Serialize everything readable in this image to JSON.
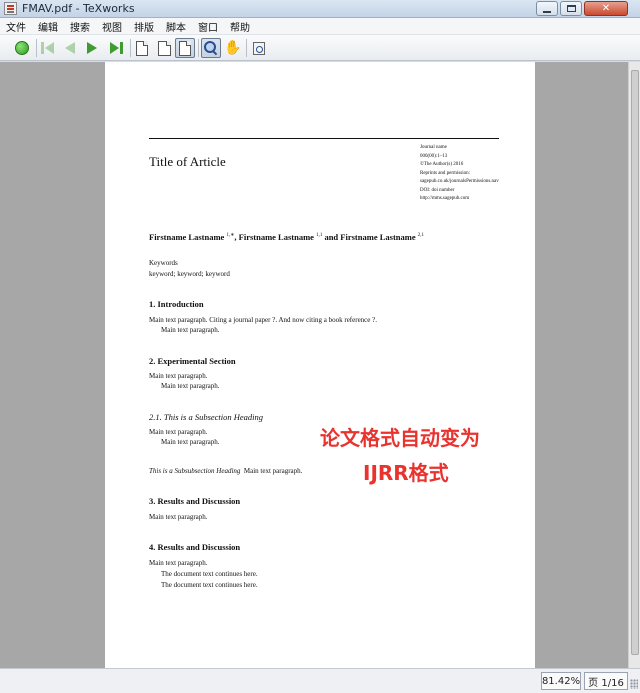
{
  "window": {
    "title": "FMAV.pdf - TeXworks"
  },
  "menu": [
    "文件",
    "编辑",
    "搜索",
    "视图",
    "排版",
    "脚本",
    "窗口",
    "帮助"
  ],
  "toolbar": {
    "icons": [
      "typeset-icon",
      "first-page-icon",
      "previous-page-icon",
      "next-page-icon",
      "last-page-icon",
      "actual-size-icon",
      "fit-width-icon",
      "fit-window-icon",
      "magnify-icon",
      "hand-scroll-icon",
      "find-source-icon"
    ]
  },
  "document": {
    "title": "Title of Article",
    "journal_info": [
      "Journal name",
      "000(00):1–13",
      "©The Author(s) 2016",
      "Reprints and permission:",
      "sagepub.co.uk/journalsPermissions.nav",
      "DOI: doi number",
      "http://mms.sagepub.com"
    ],
    "authors": {
      "a1": "Firstname Lastname",
      "a1_sup": "1,∗",
      "sep1": ", ",
      "a2": "Firstname Lastname",
      "a2_sup": "1,1",
      "sep2": " and ",
      "a3": "Firstname Lastname",
      "a3_sup": "2,1"
    },
    "keywords_heading": "Keywords",
    "keywords": "keyword; keyword; keyword",
    "sections": {
      "intro_heading": "1.  Introduction",
      "intro_p1": "Main text paragraph. Citing a journal paper ?. And now citing a book reference ?.",
      "intro_p2": "Main text paragraph.",
      "exp_heading": "2.  Experimental Section",
      "exp_p1": "Main text paragraph.",
      "exp_p2": "Main text paragraph.",
      "subsec_heading": "2.1.  This is a Subsection Heading",
      "subsec_p1": "Main text paragraph.",
      "subsec_p2": "Main text paragraph.",
      "subsubsec_heading": "This is a Subsubsection Heading",
      "subsubsec_text": "Main text paragraph.",
      "results_heading": "3.  Results and Discussion",
      "results_p1": "Main text paragraph.",
      "results2_heading": "4.  Results and Discussion",
      "results2_p1": "Main text paragraph.",
      "results2_p2": "The document text continues here.",
      "results2_p3": "The document text continues here."
    }
  },
  "annotation": {
    "line1": "论文格式自动变为",
    "line2": "IJRR格式",
    "color": "#e8332f"
  },
  "status": {
    "zoom": "81.42%",
    "page": "页 1/16"
  }
}
